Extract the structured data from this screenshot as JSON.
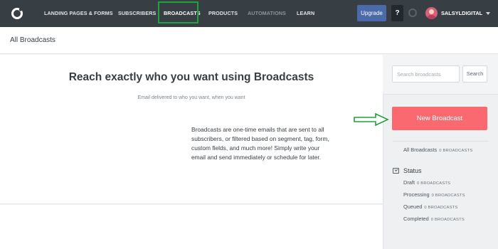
{
  "nav": {
    "items": [
      {
        "label": "LANDING PAGES & FORMS"
      },
      {
        "label": "SUBSCRIBERS"
      },
      {
        "label": "BROADCASTS"
      },
      {
        "label": "PRODUCTS"
      },
      {
        "label": "AUTOMATIONS"
      },
      {
        "label": "LEARN"
      }
    ],
    "active": "BROADCASTS",
    "upgrade_label": "Upgrade",
    "help_label": "?",
    "username": "SALSYLDIGITAL"
  },
  "header": {
    "title": "All Broadcasts"
  },
  "main": {
    "title": "Reach exactly who you want using Broadcasts",
    "subtitle": "Email delivered to who you want, when you want",
    "description": "Broadcasts are one-time emails that are sent to all subscribers, or filtered based on segment, tag, form, custom fields, and much more! Simply write your email and send immediately or schedule for later."
  },
  "sidebar": {
    "search_placeholder": "Search broadcasts",
    "search_button": "Search",
    "new_broadcast_label": "New Broadcast",
    "all_broadcasts": {
      "label": "All Broadcasts",
      "count": "0 BROADCASTS"
    },
    "status": {
      "title": "Status",
      "items": [
        {
          "label": "Draft",
          "count": "0 BROADCASTS"
        },
        {
          "label": "Processing",
          "count": "0 BROADCASTS"
        },
        {
          "label": "Queued",
          "count": "0 BROADCASTS"
        },
        {
          "label": "Completed",
          "count": "0 BROADCASTS"
        }
      ]
    }
  },
  "colors": {
    "nav_bg": "#373f45",
    "highlight_box": "#1fa33a",
    "upgrade": "#4a6aa9",
    "new_broadcast": "#fb6970",
    "annotation_arrow": "#1fa33a"
  },
  "icons": [
    "logo-icon",
    "help-icon",
    "loading-icon",
    "avatar",
    "caret-down-icon",
    "status-icon",
    "arrow-right-icon"
  ]
}
